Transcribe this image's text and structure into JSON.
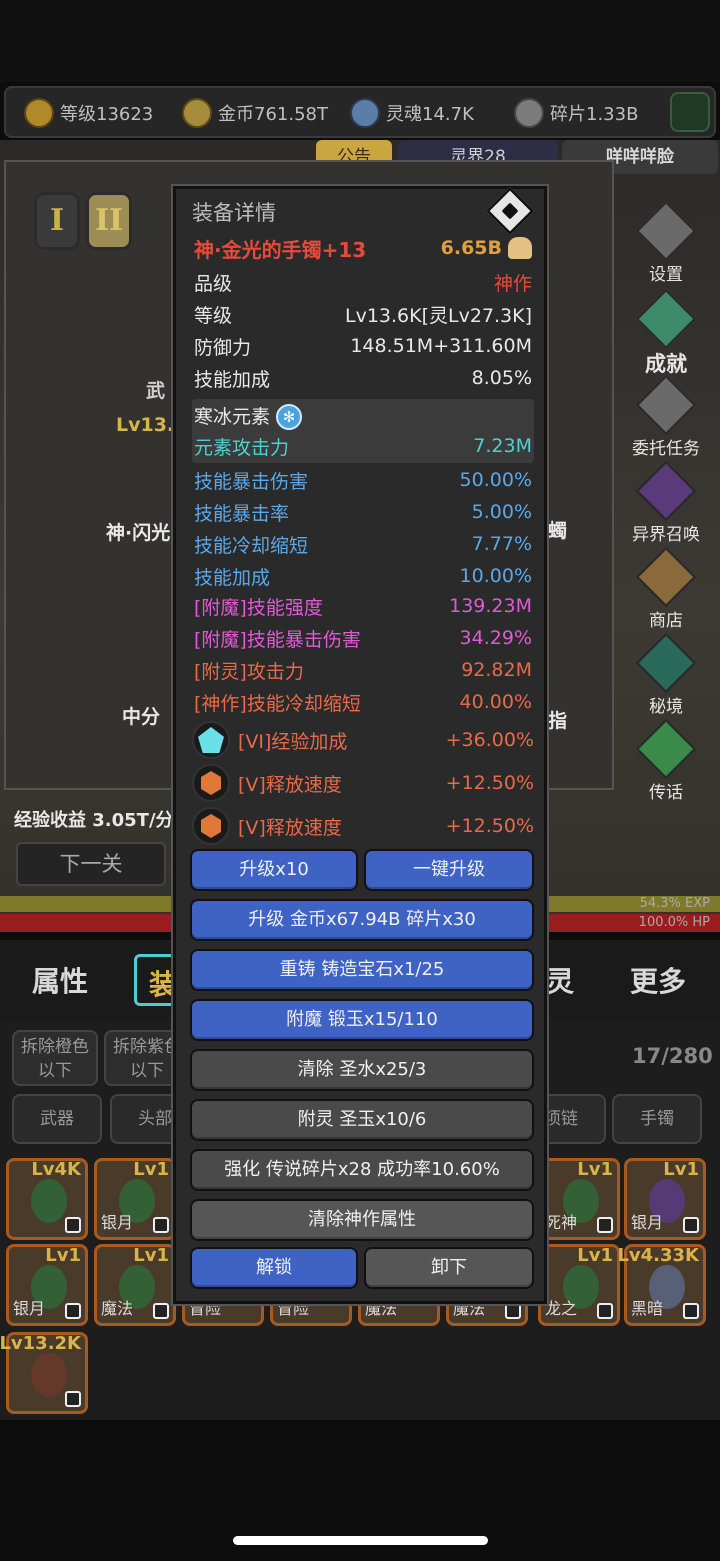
{
  "resources": [
    {
      "icon": "crown-icon",
      "label": "等级13623"
    },
    {
      "icon": "coin-icon",
      "label": "金币761.58T"
    },
    {
      "icon": "soul-icon",
      "label": "灵魂14.7K"
    },
    {
      "icon": "fragment-icon",
      "label": "碎片1.33B"
    }
  ],
  "top_tabs": [
    "公告",
    "灵界28",
    "咩咩咩脸"
  ],
  "roman_tabs": [
    "I",
    "II"
  ],
  "side_menu": [
    "设置",
    "成就",
    "委托任务",
    "异界召唤",
    "商店",
    "秘境",
    "传话"
  ],
  "background": {
    "weapon_label": "武",
    "level_label": "Lv13.",
    "item_name_partial": "神·闪光",
    "score_partial": "中分",
    "exp_income": "经验收益 3.05T/分",
    "next_level": "下一关",
    "side_text_1": "蠋",
    "side_text_2": "指",
    "exp_text": "54.3% EXP",
    "hp_text": "100.0%  HP"
  },
  "bottom_tabs": [
    "属性",
    "装",
    "灵",
    "更多"
  ],
  "inventory": {
    "filters": [
      "拆除橙色以下",
      "拆除紫色以下"
    ],
    "count": "17/280",
    "slots": [
      "武器",
      "头部",
      "项链",
      "手镯"
    ],
    "items_row1": [
      {
        "lv": "Lv4K",
        "name": ""
      },
      {
        "lv": "Lv1",
        "name": "银月"
      },
      {
        "lv": "Lv1",
        "name": "死神"
      },
      {
        "lv": "Lv1",
        "name": "银月"
      }
    ],
    "items_row2": [
      {
        "lv": "Lv1",
        "name": "银月"
      },
      {
        "lv": "Lv1",
        "name": "魔法"
      },
      {
        "lv": "",
        "name": "冒险"
      },
      {
        "lv": "",
        "name": "冒险"
      },
      {
        "lv": "",
        "name": "魔法"
      },
      {
        "lv": "",
        "name": "魔法"
      },
      {
        "lv": "Lv1",
        "name": "龙之"
      },
      {
        "lv": "Lv4.33K",
        "name": "黑暗"
      }
    ],
    "items_row3": [
      {
        "lv": "Lv13.2K",
        "name": ""
      }
    ]
  },
  "detail": {
    "title": "装备详情",
    "item_name": "神·金光的手镯+13",
    "power": "6.65B",
    "stats": [
      {
        "label": "品级",
        "value": "神作"
      },
      {
        "label": "等级",
        "value": "Lv13.6K[灵Lv27.3K]"
      },
      {
        "label": "防御力",
        "value": "148.51M+311.60M"
      },
      {
        "label": "技能加成",
        "value": "8.05%"
      }
    ],
    "element": {
      "name": "寒冰元素",
      "icon": "snowflake-icon",
      "attack_label": "元素攻击力",
      "attack_value": "7.23M"
    },
    "affixes_blue": [
      {
        "label": "技能暴击伤害",
        "value": "50.00%"
      },
      {
        "label": "技能暴击率",
        "value": "5.00%"
      },
      {
        "label": "技能冷却缩短",
        "value": "7.77%"
      },
      {
        "label": "技能加成",
        "value": "10.00%"
      }
    ],
    "affixes_mag": [
      {
        "label": "[附魔]技能强度",
        "value": "139.23M"
      },
      {
        "label": "[附魔]技能暴击伤害",
        "value": "34.29%"
      }
    ],
    "affixes_red": [
      {
        "label": "[附灵]攻击力",
        "value": "92.82M"
      },
      {
        "label": "[神作]技能冷却缩短",
        "value": "40.00%"
      }
    ],
    "gems": [
      {
        "icon": "cyan-gem-icon",
        "label": "[VI]经验加成",
        "value": "+36.00%"
      },
      {
        "icon": "orange-gem-icon",
        "label": "[V]释放速度",
        "value": "+12.50%"
      },
      {
        "icon": "orange-gem-icon",
        "label": "[V]释放速度",
        "value": "+12.50%"
      }
    ],
    "buttons": {
      "upgrade10": "升级x10",
      "upgrade_all": "一键升级",
      "upgrade_cost": "升级 金币x67.94B 碎片x30",
      "reforge": "重铸 铸造宝石x1/25",
      "enchant": "附魔 锻玉x15/110",
      "clear": "清除 圣水x25/3",
      "spirit": "附灵 圣玉x10/6",
      "strengthen": "强化 传说碎片x28 成功率10.60%",
      "clear_divine": "清除神作属性",
      "unlock": "解锁",
      "unequip": "卸下"
    }
  },
  "colors": {
    "item_name": "#e84a3a",
    "power": "#e0a040",
    "element": "#4fd1d1",
    "affix_blue": "#5ba8e8",
    "affix_enchant": "#e05ad6",
    "affix_red": "#e86a4a",
    "button_blue": "#3e63c4",
    "button_gray": "#4a4a4a"
  }
}
